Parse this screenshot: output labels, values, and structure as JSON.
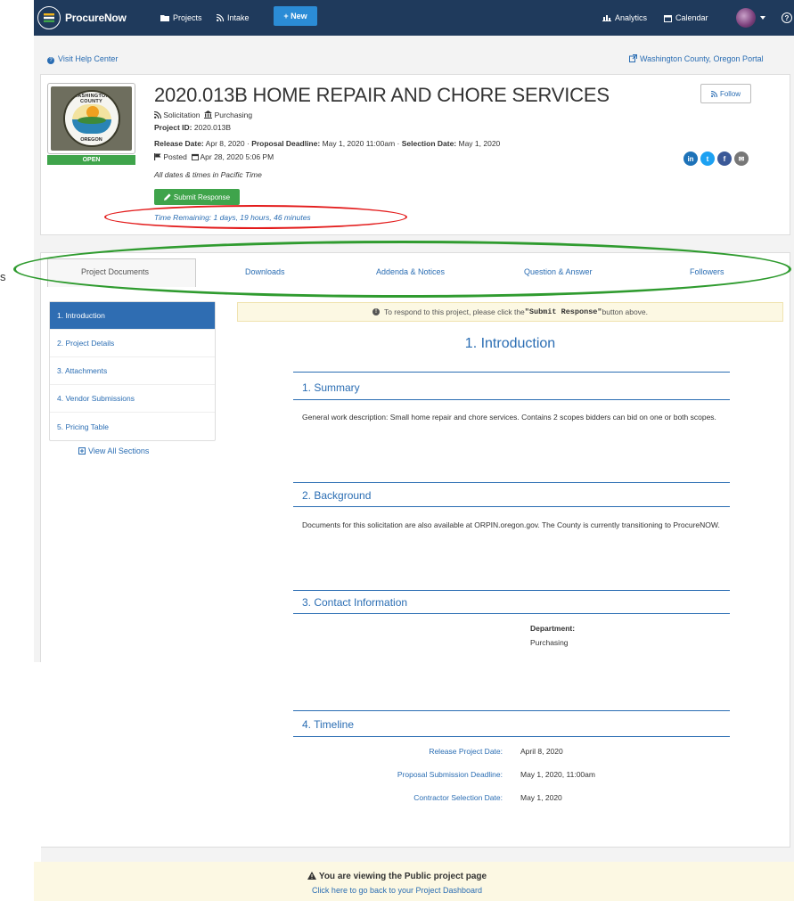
{
  "navbar": {
    "brand": "ProcureNow",
    "projects": "Projects",
    "intake": "Intake",
    "new": "+ New",
    "analytics": "Analytics",
    "calendar": "Calendar",
    "help": "?",
    "bg_color": "#1f3a5c"
  },
  "toplinks": {
    "help_center": "Visit Help Center",
    "portal": "Washington County, Oregon Portal"
  },
  "project": {
    "title": "2020.013B HOME REPAIR AND CHORE SERVICES",
    "type": "Solicitation",
    "department": "Purchasing",
    "id_label": "Project ID:",
    "id_value": "2020.013B",
    "release_label": "Release Date:",
    "release_value": "Apr 8, 2020 ·",
    "deadline_label": "Proposal Deadline:",
    "deadline_value": "May 1, 2020 11:00am ·",
    "selection_label": "Selection Date:",
    "selection_value": "May 1, 2020",
    "posted_label": "Posted",
    "posted_value": "Apr 28, 2020 5:06 PM",
    "tz_note": "All dates & times in Pacific Time",
    "status": "OPEN",
    "follow": "Follow",
    "submit": "Submit Response",
    "time_remaining": "Time Remaining: 1 days, 19 hours, 46 minutes",
    "seal_top": "WASHINGTON COUNTY",
    "seal_bottom": "OREGON"
  },
  "social": {
    "linkedin": "in",
    "twitter": "t",
    "facebook": "f",
    "email": "✉",
    "colors": [
      "#1d72b8",
      "#1da1f2",
      "#3b5998",
      "#777777"
    ]
  },
  "tabs": [
    "Project Documents",
    "Downloads",
    "Addenda & Notices",
    "Question & Answer",
    "Followers"
  ],
  "sidenav": {
    "items": [
      "1. Introduction",
      "2. Project Details",
      "3. Attachments",
      "4. Vendor Submissions",
      "5. Pricing Table"
    ],
    "view_all": "View All Sections"
  },
  "notice": {
    "pre": "To respond to this project, please click the ",
    "bold": "\"Submit Response\"",
    "post": " button above."
  },
  "document": {
    "heading": "1. Introduction",
    "sections": [
      {
        "title": "1. Summary",
        "body": "General work description: Small home repair and chore services.  Contains 2 scopes bidders can bid on one or both scopes."
      },
      {
        "title": "2. Background",
        "body": "Documents for this solicitation are also available at ORPIN.oregon.gov.  The County is currently transitioning to ProcureNOW."
      },
      {
        "title": "3. Contact Information",
        "body": ""
      },
      {
        "title": "4. Timeline",
        "body": ""
      }
    ],
    "contact": {
      "label": "Department:",
      "value": "Purchasing"
    },
    "timeline": [
      {
        "label": "Release Project Date:",
        "value": "April 8, 2020"
      },
      {
        "label": "Proposal Submission Deadline:",
        "value": "May 1, 2020, 11:00am"
      },
      {
        "label": "Contractor Selection Date:",
        "value": "May 1, 2020"
      }
    ]
  },
  "footer": {
    "line1": "You are viewing the Public project page",
    "line2": "Click here to go back to your Project Dashboard"
  },
  "annotations": {
    "red": "#e31b1b",
    "green": "#2f9b2f",
    "edge_glyph": "s"
  }
}
